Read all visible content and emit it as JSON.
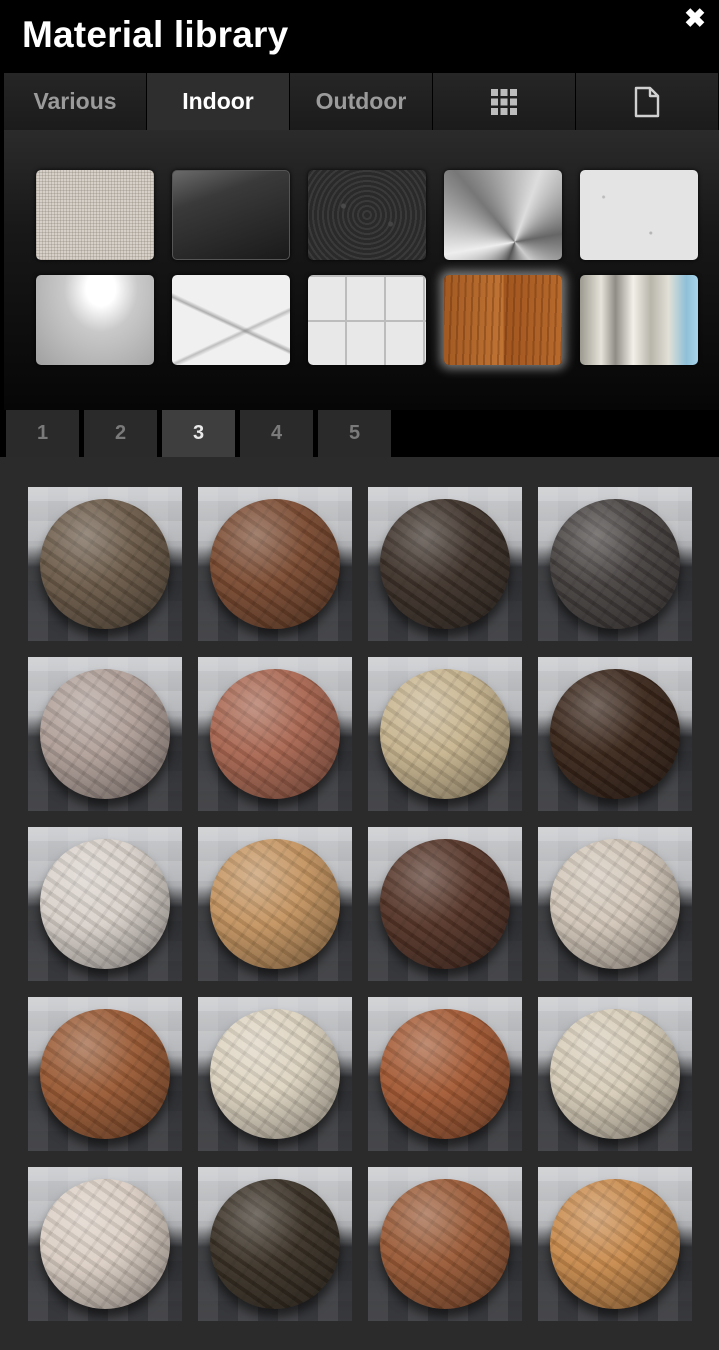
{
  "window": {
    "title": "Material library",
    "close_icon": "close-icon"
  },
  "tabs": [
    {
      "label": "Various",
      "active": false
    },
    {
      "label": "Indoor",
      "active": true
    },
    {
      "label": "Outdoor",
      "active": false
    },
    {
      "icon": "grid-icon"
    },
    {
      "icon": "document-icon"
    }
  ],
  "swatches": [
    {
      "name": "linen-fabric",
      "selected": false
    },
    {
      "name": "dark-glass",
      "selected": false
    },
    {
      "name": "black-leather",
      "selected": false
    },
    {
      "name": "brushed-steel",
      "selected": false
    },
    {
      "name": "white-stucco",
      "selected": false
    },
    {
      "name": "glossy-white",
      "selected": false
    },
    {
      "name": "white-marble",
      "selected": false
    },
    {
      "name": "white-tile",
      "selected": false
    },
    {
      "name": "wood-floor",
      "selected": true
    },
    {
      "name": "curtain",
      "selected": false
    }
  ],
  "pages": [
    "1",
    "2",
    "3",
    "4",
    "5"
  ],
  "active_page": "3",
  "materials": [
    {
      "color": "#6b5a48"
    },
    {
      "color": "#7a4a30"
    },
    {
      "color": "#3d3129"
    },
    {
      "color": "#46413f"
    },
    {
      "color": "#b09f98"
    },
    {
      "color": "#a96650"
    },
    {
      "color": "#c7b48e"
    },
    {
      "color": "#3a261a"
    },
    {
      "color": "#d9d1ca"
    },
    {
      "color": "#c49460"
    },
    {
      "color": "#553427"
    },
    {
      "color": "#d2c6b8"
    },
    {
      "color": "#9a5a34"
    },
    {
      "color": "#ddd3c0"
    },
    {
      "color": "#a45a34"
    },
    {
      "color": "#d7ccb8"
    },
    {
      "color": "#dbcfc4"
    },
    {
      "color": "#3a3126"
    },
    {
      "color": "#9a5a36"
    },
    {
      "color": "#c88a4c"
    }
  ]
}
